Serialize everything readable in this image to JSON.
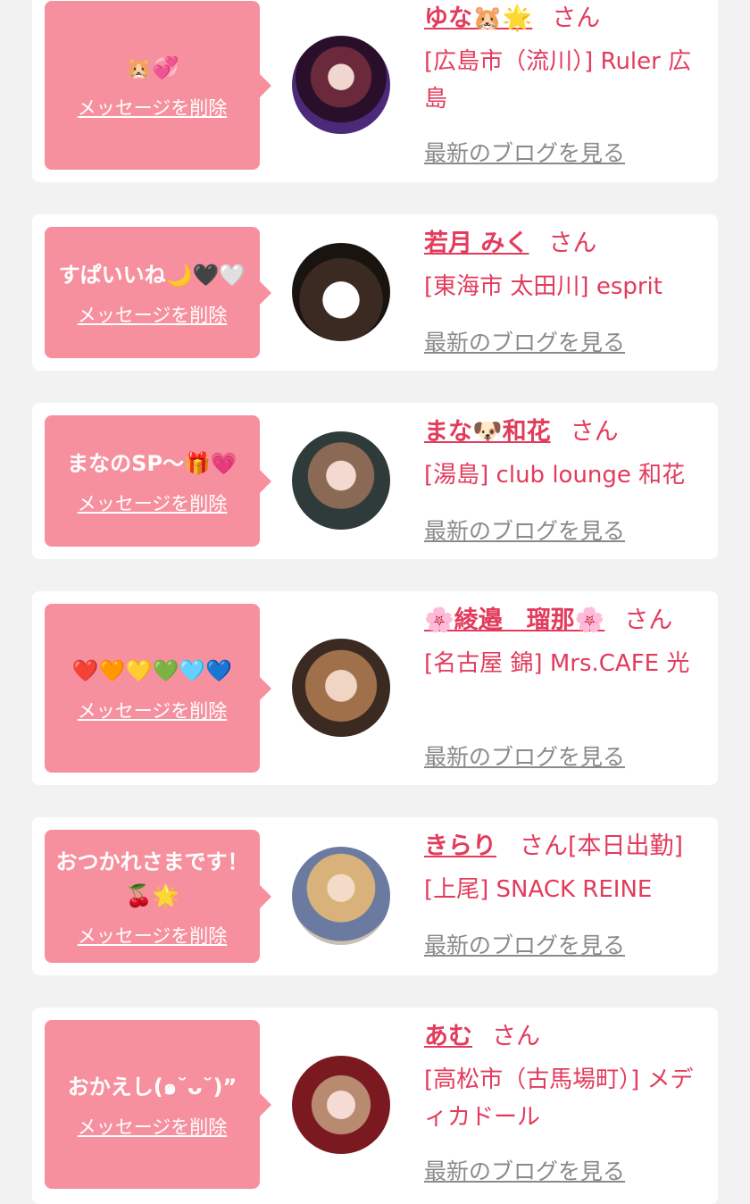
{
  "cards": [
    {
      "message": "🐹💞",
      "delete_label": "メッセージを削除",
      "name": "ゆな🐹🌟",
      "san": "さん",
      "shop": "[広島市（流川）] Ruler 広島",
      "blog_label": "最新のブログを見る"
    },
    {
      "message": "すぱいいね🌙🖤🤍",
      "delete_label": "メッセージを削除",
      "name": "若月 みく",
      "san": "さん",
      "shop": "[東海市 太田川] esprit",
      "blog_label": "最新のブログを見る"
    },
    {
      "message": "まなのSP〜🎁💗",
      "delete_label": "メッセージを削除",
      "name": "まな🐶和花",
      "san": "さん",
      "shop": "[湯島] club lounge 和花",
      "blog_label": "最新のブログを見る"
    },
    {
      "message": "❤️🧡💛💚🩵💙",
      "delete_label": "メッセージを削除",
      "name": "🌸綾邉　瑠那🌸",
      "san": "さん",
      "shop": "[名古屋 錦] Mrs.CAFE 光",
      "blog_label": "最新のブログを見る"
    },
    {
      "message": "おつかれさまです！🍒🌟",
      "delete_label": "メッセージを削除",
      "name": "きらり",
      "san": "さん[本日出勤]",
      "shop": "[上尾] SNACK REINE",
      "blog_label": "最新のブログを見る"
    },
    {
      "message": "おかえし(๑˘ᴗ˘)”",
      "delete_label": "メッセージを削除",
      "name": "あむ",
      "san": "さん",
      "shop": "[高松市（古馬場町）] メディカドール",
      "blog_label": "最新のブログを見る"
    }
  ]
}
